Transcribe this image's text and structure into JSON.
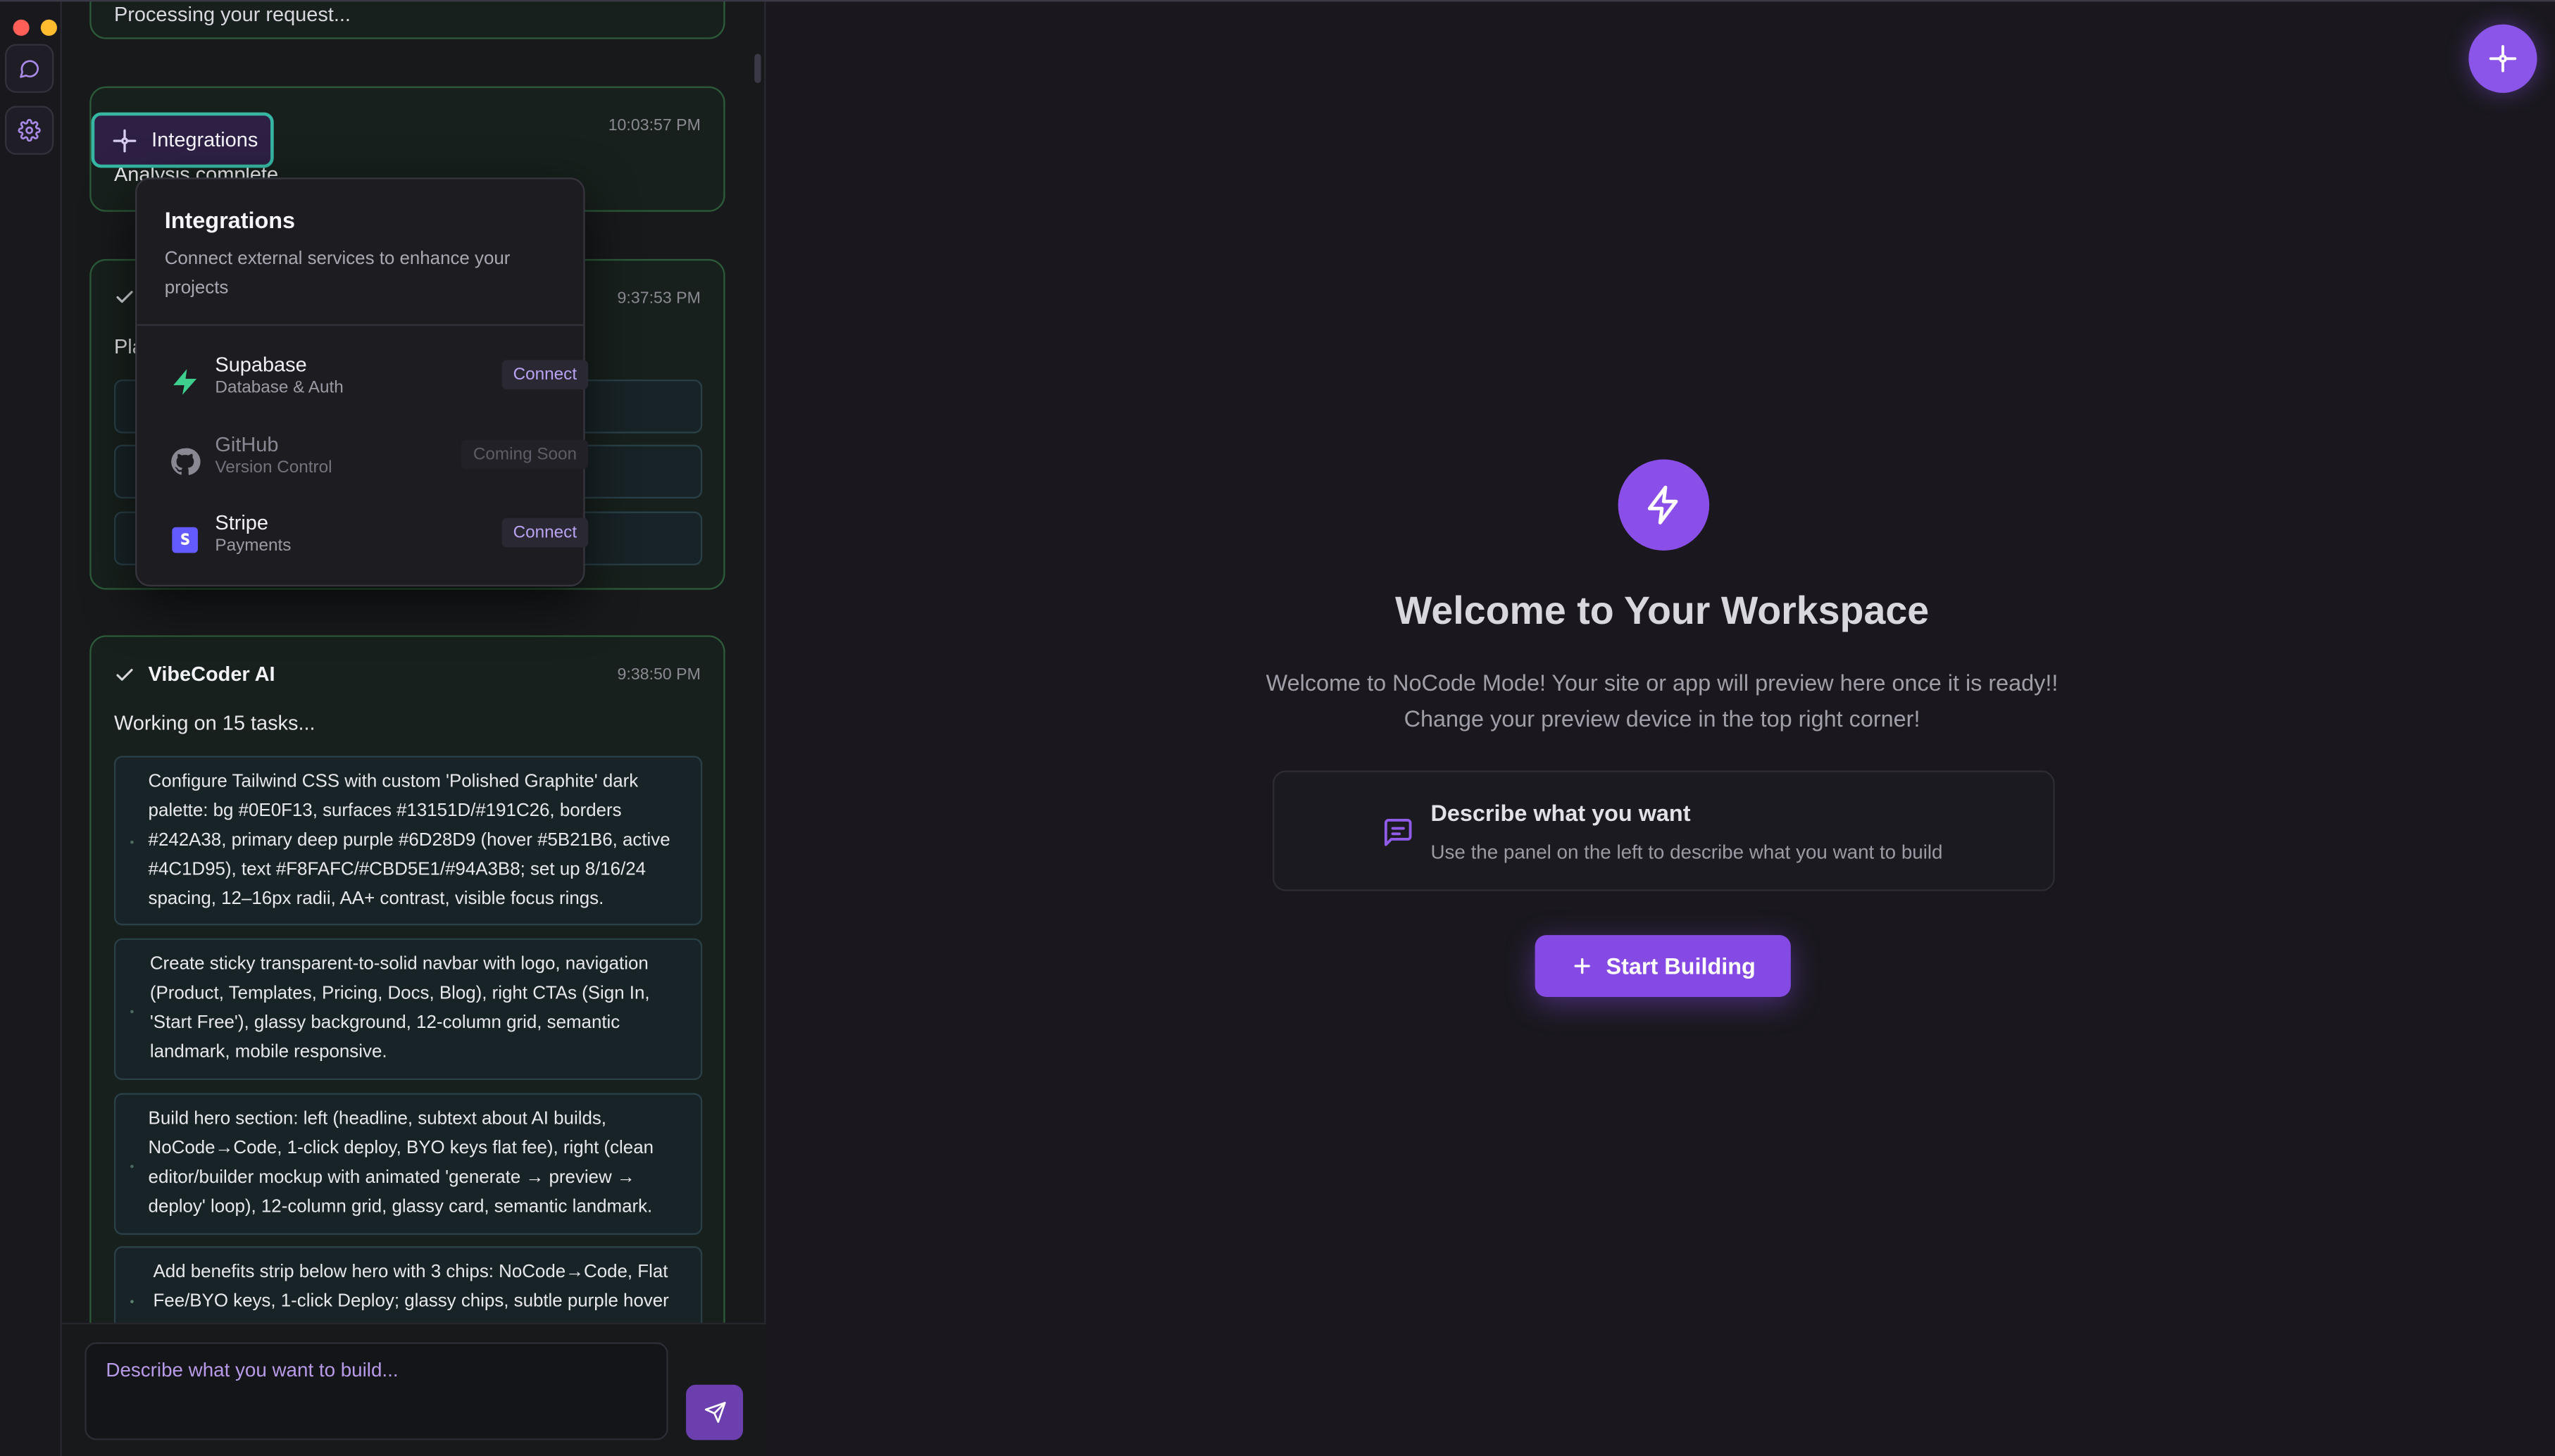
{
  "rail": {
    "icons": [
      "chat-bubble-icon",
      "gear-icon"
    ]
  },
  "chat": {
    "top_card_text": "Processing your request...",
    "card2": {
      "time": "10:03:57 PM",
      "text": "Analysis complete"
    },
    "card3": {
      "time": "9:37:53 PM",
      "text": "Pla"
    },
    "card4": {
      "title": "VibeCoder AI",
      "time": "9:38:50 PM",
      "status": "Working on 15 tasks...",
      "tasks": [
        "Configure Tailwind CSS with custom 'Polished Graphite' dark palette: bg #0E0F13, surfaces #13151D/#191C26, borders #242A38, primary deep purple #6D28D9 (hover #5B21B6, active #4C1D95), text #F8FAFC/#CBD5E1/#94A3B8; set up 8/16/24 spacing, 12–16px radii, AA+ contrast, visible focus rings.",
        "Create sticky transparent-to-solid navbar with logo, navigation (Product, Templates, Pricing, Docs, Blog), right CTAs (Sign In, 'Start Free'), glassy background, 12-column grid, semantic landmark, mobile responsive.",
        "Build hero section: left (headline, subtext about AI builds, NoCode→Code, 1-click deploy, BYO keys flat fee), right (clean editor/builder mockup with animated 'generate → preview → deploy' loop), 12-column grid, glassy card, semantic landmark.",
        "Add benefits strip below hero with 3 chips: NoCode→Code, Flat Fee/BYO keys, 1-click Deploy; glassy chips, subtle purple hover"
      ]
    },
    "composer_placeholder": "Describe what you want to build..."
  },
  "integrations": {
    "chip_label": "Integrations",
    "title": "Integrations",
    "description": "Connect external services to enhance your projects",
    "services": [
      {
        "name": "Supabase",
        "sub": "Database & Auth",
        "action": "Connect",
        "icon": "bolt-icon",
        "color": "#3ecf8e"
      },
      {
        "name": "GitHub",
        "sub": "Version Control",
        "action": "Coming Soon",
        "icon": "github-icon",
        "color": "#8a8893"
      },
      {
        "name": "Stripe",
        "sub": "Payments",
        "action": "Connect",
        "icon": "stripe-icon",
        "color": "#635bff"
      }
    ]
  },
  "workspace": {
    "title": "Welcome to Your Workspace",
    "subtitle_line1": "Welcome to NoCode Mode! Your site or app will preview here once it is ready!!",
    "subtitle_line2": "Change your preview device in the top right corner!",
    "describe_title": "Describe what you want",
    "describe_desc": "Use the panel on the left to describe what you want to build",
    "start_button": "Start Building"
  },
  "colors": {
    "accent": "#8a4ee9",
    "success_border": "#2c5a3a",
    "focus_ring": "#35b7a3"
  }
}
